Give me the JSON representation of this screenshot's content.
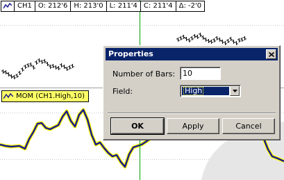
{
  "info_bar": {
    "symbol": "CH1",
    "open": "O: 212'6",
    "high": "H: 213'0",
    "low": "L: 211'4",
    "close": "C: 211'4",
    "change": "Δ: -2'0"
  },
  "indicator": {
    "label": "MOM (CH1.High,10)"
  },
  "dialog": {
    "title": "Properties",
    "bars_label": "Number of Bars:",
    "bars_value": "10",
    "field_label": "Field:",
    "field_value": "High",
    "ok_label": "OK",
    "apply_label": "Apply",
    "cancel_label": "Cancel"
  },
  "colors": {
    "indicator_line": "#1a1a8c",
    "indicator_label_bg": "#ffff66",
    "crosshair": "#00a000",
    "dialog_face": "#d4d0c8",
    "titlebar": "#0a246a"
  }
}
